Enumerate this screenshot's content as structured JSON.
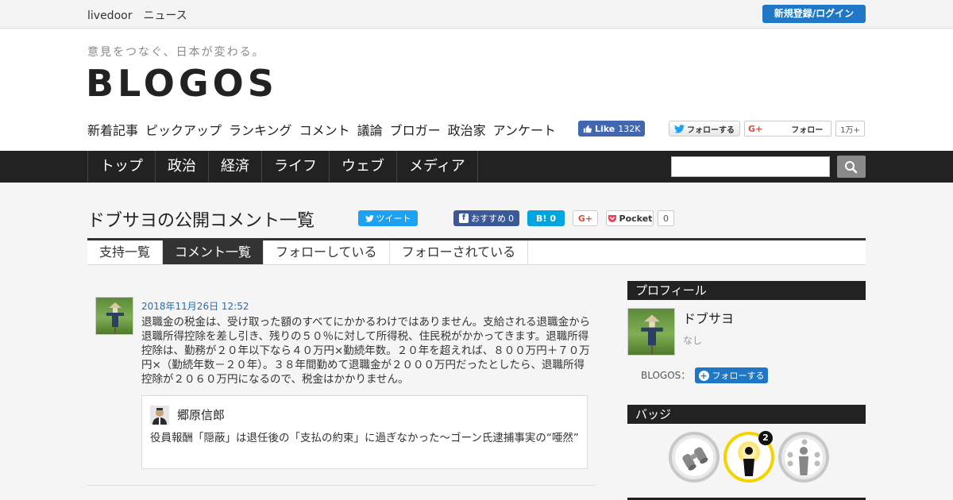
{
  "topbar": {
    "brand": "livedoor　ニュース",
    "login": "新規登録/ログイン"
  },
  "header": {
    "tagline": "意見をつなぐ、日本が変わる。",
    "logo": "BLOGOS",
    "nav": [
      "新着記事",
      "ピックアップ",
      "ランキング",
      "コメント",
      "議論",
      "ブロガー",
      "政治家",
      "アンケート"
    ],
    "fb_like": "Like",
    "fb_count": "132K",
    "tw_follow": "フォローする",
    "gp_follow": "フォロー",
    "gp_count": "1万+"
  },
  "category_nav": [
    "トップ",
    "政治",
    "経済",
    "ライフ",
    "ウェブ",
    "メディア"
  ],
  "search": {
    "placeholder": ""
  },
  "page": {
    "title": "ドブサヨの公開コメント一覧",
    "share": {
      "tweet": "ツイート",
      "fb": "おすすめ",
      "fb_count": "0",
      "hatena": "B!",
      "hatena_count": "0",
      "gplus": "G+",
      "pocket": "Pocket",
      "pocket_count": "0"
    },
    "tabs": [
      "支持一覧",
      "コメント一覧",
      "フォローしている",
      "フォローされている"
    ],
    "active_tab": 1
  },
  "comment": {
    "date": "2018年11月26日 12:52",
    "body": "退職金の税金は、受け取った額のすべてにかかるわけではありません。支給される退職金から退職所得控除を差し引き、残りの５０％に対して所得税、住民税がかかってきます。退職所得控除は、勤務が２０年以下なら４０万円×勤続年数。２０年を超えれば、８００万円＋７０万円×（勤続年数－２０年）。３８年間勤めて退職金が２０００万円だったとしたら、退職所得控除が２０６０万円になるので、税金はかかりません。",
    "quote": {
      "author": "郷原信郎",
      "title": "役員報酬「隠蔽」は退任後の「支払の約束」に過ぎなかった～ゴーン氏逮捕事実の“唖然”"
    }
  },
  "sidebar": {
    "profile_header": "プロフィール",
    "name": "ドブサヨ",
    "sub": "なし",
    "blogos_label": "BLOGOS：",
    "follow": "フォローする",
    "badges_header": "バッジ",
    "badge_count": "2"
  },
  "colors": {
    "accent_blue": "#1f77c5",
    "dark_nav": "#222222",
    "badge_yellow": "#f5d300"
  }
}
